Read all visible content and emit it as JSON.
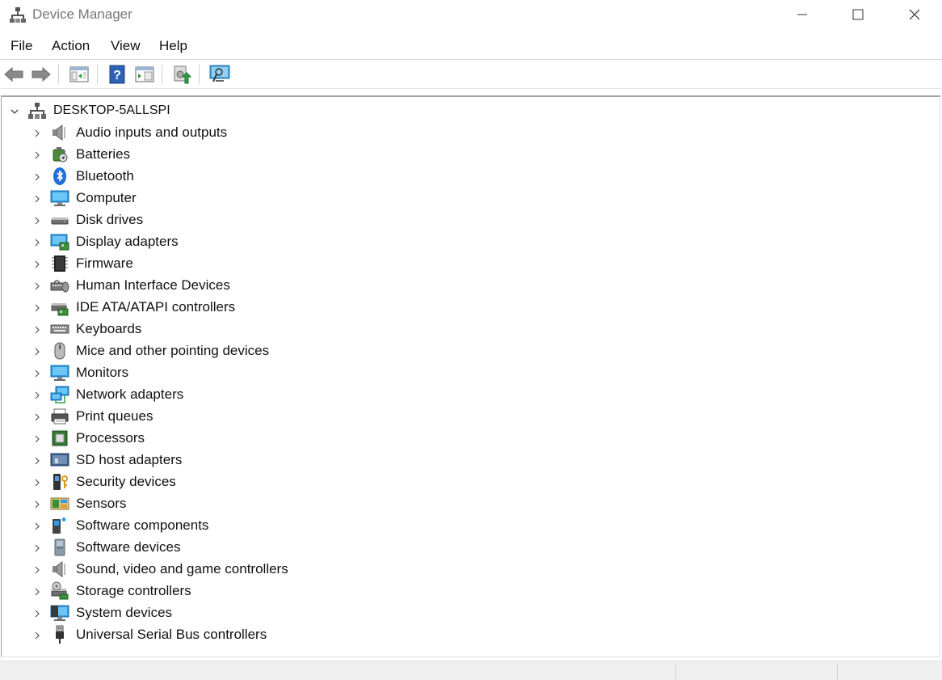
{
  "window": {
    "title": "Device Manager"
  },
  "menu": {
    "items": [
      "File",
      "Action",
      "View",
      "Help"
    ]
  },
  "toolbar": {
    "buttons": [
      "back-arrow-icon",
      "forward-arrow-icon",
      "properties-pane-icon",
      "help-icon",
      "action-pane-icon",
      "update-driver-icon",
      "scan-hardware-icon"
    ]
  },
  "tree": {
    "root": "DESKTOP-5ALLSPI",
    "items": [
      {
        "label": "Audio inputs and outputs",
        "icon": "speaker-icon"
      },
      {
        "label": "Batteries",
        "icon": "battery-icon"
      },
      {
        "label": "Bluetooth",
        "icon": "bluetooth-icon"
      },
      {
        "label": "Computer",
        "icon": "computer-icon"
      },
      {
        "label": "Disk drives",
        "icon": "disk-drive-icon"
      },
      {
        "label": "Display adapters",
        "icon": "display-adapter-icon"
      },
      {
        "label": "Firmware",
        "icon": "firmware-chip-icon"
      },
      {
        "label": "Human Interface Devices",
        "icon": "hid-icon"
      },
      {
        "label": "IDE ATA/ATAPI controllers",
        "icon": "ide-controller-icon"
      },
      {
        "label": "Keyboards",
        "icon": "keyboard-icon"
      },
      {
        "label": "Mice and other pointing devices",
        "icon": "mouse-icon"
      },
      {
        "label": "Monitors",
        "icon": "monitor-icon"
      },
      {
        "label": "Network adapters",
        "icon": "network-adapter-icon"
      },
      {
        "label": "Print queues",
        "icon": "printer-icon"
      },
      {
        "label": "Processors",
        "icon": "processor-icon"
      },
      {
        "label": "SD host adapters",
        "icon": "sd-card-icon"
      },
      {
        "label": "Security devices",
        "icon": "security-key-icon"
      },
      {
        "label": "Sensors",
        "icon": "sensor-icon"
      },
      {
        "label": "Software components",
        "icon": "software-component-icon"
      },
      {
        "label": "Software devices",
        "icon": "software-device-icon"
      },
      {
        "label": "Sound, video and game controllers",
        "icon": "sound-controller-icon"
      },
      {
        "label": "Storage controllers",
        "icon": "storage-controller-icon"
      },
      {
        "label": "System devices",
        "icon": "system-devices-icon"
      },
      {
        "label": "Universal Serial Bus controllers",
        "icon": "usb-icon"
      }
    ]
  },
  "colors": {
    "accent_blue": "#1e88e5",
    "border": "#a0a0a0"
  }
}
